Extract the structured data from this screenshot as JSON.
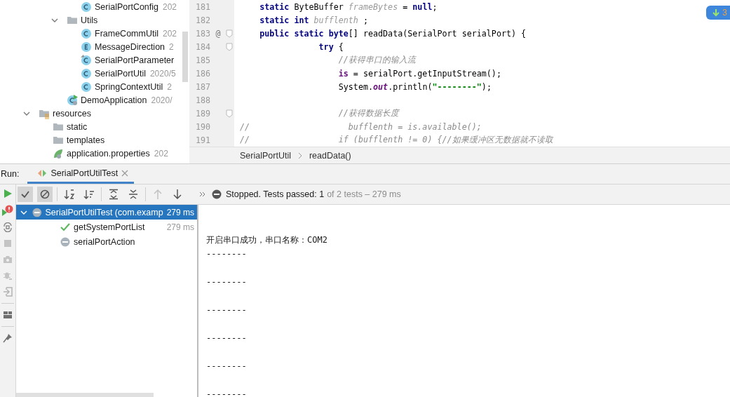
{
  "project_tree": [
    {
      "children": [
        {
          "children": [
            {
              "children": [
                {
                  "label": "SerialPortConfig",
                  "kind": "class",
                  "date": "202"
                }
              ]
            },
            {
              "label": "Utils",
              "kind": "folder",
              "expanded": true,
              "children": [
                {
                  "label": "FrameCommUtil",
                  "kind": "class",
                  "date": "202"
                },
                {
                  "label": "MessageDirection",
                  "kind": "enum",
                  "date": "2"
                },
                {
                  "label": "SerialPortParameter",
                  "kind": "class-config"
                },
                {
                  "label": "SerialPortUtil",
                  "kind": "class",
                  "date": "2020/5"
                },
                {
                  "label": "SpringContextUtil",
                  "kind": "class",
                  "date": "2"
                }
              ]
            },
            {
              "label": "DemoApplication",
              "kind": "spring-app",
              "date": "2020/"
            }
          ]
        }
      ]
    },
    {
      "label": "resources",
      "kind": "resources-folder",
      "expanded": true,
      "children": [
        {
          "label": "static",
          "kind": "folder"
        },
        {
          "label": "templates",
          "kind": "folder"
        },
        {
          "label": "application.properties",
          "kind": "properties",
          "date": "202"
        }
      ]
    }
  ],
  "editor": {
    "lines": [
      {
        "number": "181",
        "tokens": [
          {
            "t": "    static",
            "kind": "keyword"
          },
          {
            "t": " ByteBuffer ",
            "kind": "plain"
          },
          {
            "t": "frameBytes",
            "kind": "unused"
          },
          {
            "t": " = ",
            "kind": "plain"
          },
          {
            "t": "null",
            "kind": "keyword"
          },
          {
            "t": ";",
            "kind": "plain"
          }
        ]
      },
      {
        "number": "182",
        "tokens": [
          {
            "t": "    static int",
            "kind": "keyword"
          },
          {
            "t": " bufflenth",
            "kind": "unused"
          },
          {
            "t": " ;",
            "kind": "plain"
          }
        ]
      },
      {
        "number": "183",
        "mark": "@",
        "foldable": true,
        "tokens": [
          {
            "t": "    public static byte",
            "kind": "keyword"
          },
          {
            "t": "[] readData(SerialPort serialPort) {",
            "kind": "plain"
          }
        ]
      },
      {
        "number": "184",
        "foldable": true,
        "tokens": [
          {
            "t": "                try",
            "kind": "keyword"
          },
          {
            "t": " {",
            "kind": "plain"
          }
        ]
      },
      {
        "number": "185",
        "tokens": [
          {
            "t": "                    //获得串口的输入流",
            "kind": "comment"
          }
        ]
      },
      {
        "number": "186",
        "tokens": [
          {
            "t": "                    is",
            "kind": "field"
          },
          {
            "t": " = serialPort.getInputStream();",
            "kind": "plain"
          }
        ]
      },
      {
        "number": "187",
        "tokens": [
          {
            "t": "                    System.",
            "kind": "plain"
          },
          {
            "t": "out",
            "kind": "static-field"
          },
          {
            "t": ".println(",
            "kind": "plain"
          },
          {
            "t": "\"--------\"",
            "kind": "string"
          },
          {
            "t": ");",
            "kind": "plain"
          }
        ]
      },
      {
        "number": "188"
      },
      {
        "number": "189",
        "foldable": true,
        "tokens": [
          {
            "t": "                    //获得数据长度",
            "kind": "comment"
          }
        ]
      },
      {
        "number": "190",
        "tokens": [
          {
            "t": "//                    bufflenth = is.available();",
            "kind": "comment"
          }
        ]
      },
      {
        "number": "191",
        "tokens": [
          {
            "t": "//                  if (bufflenth != 0) {//如果缓冲区无数据就不读取",
            "kind": "comment"
          }
        ]
      }
    ],
    "breadcrumbs": [
      "SerialPortUtil",
      "readData()"
    ]
  },
  "notification": {
    "count": "3"
  },
  "run": {
    "label": "Run:",
    "tabs": [
      {
        "title": "SerialPortUtilTest",
        "selected": true
      }
    ],
    "toolbar": {
      "show_passed": {
        "pressed": true
      },
      "show_ignored": {
        "pressed": true
      },
      "previous": {
        "disabled": true
      },
      "next": {
        "disabled": false
      }
    },
    "status": {
      "summary": "Stopped. Tests passed: 1",
      "detail": "of 2 tests – 279 ms"
    },
    "tests": [
      {
        "label": "SerialPortUtilTest (com.examp",
        "duration": "279 ms",
        "kind": "ignored",
        "selected": true,
        "expanded": true,
        "children": [
          {
            "label": "getSystemPortList",
            "duration": "279 ms",
            "kind": "passed",
            "selected": false
          },
          {
            "label": "serialPortAction",
            "kind": "ignored",
            "selected": false
          }
        ]
      }
    ],
    "console": [
      "开启串口成功，串口名称：COM2",
      "--------",
      "--------",
      "--------",
      "--------",
      "--------",
      "--------"
    ]
  }
}
